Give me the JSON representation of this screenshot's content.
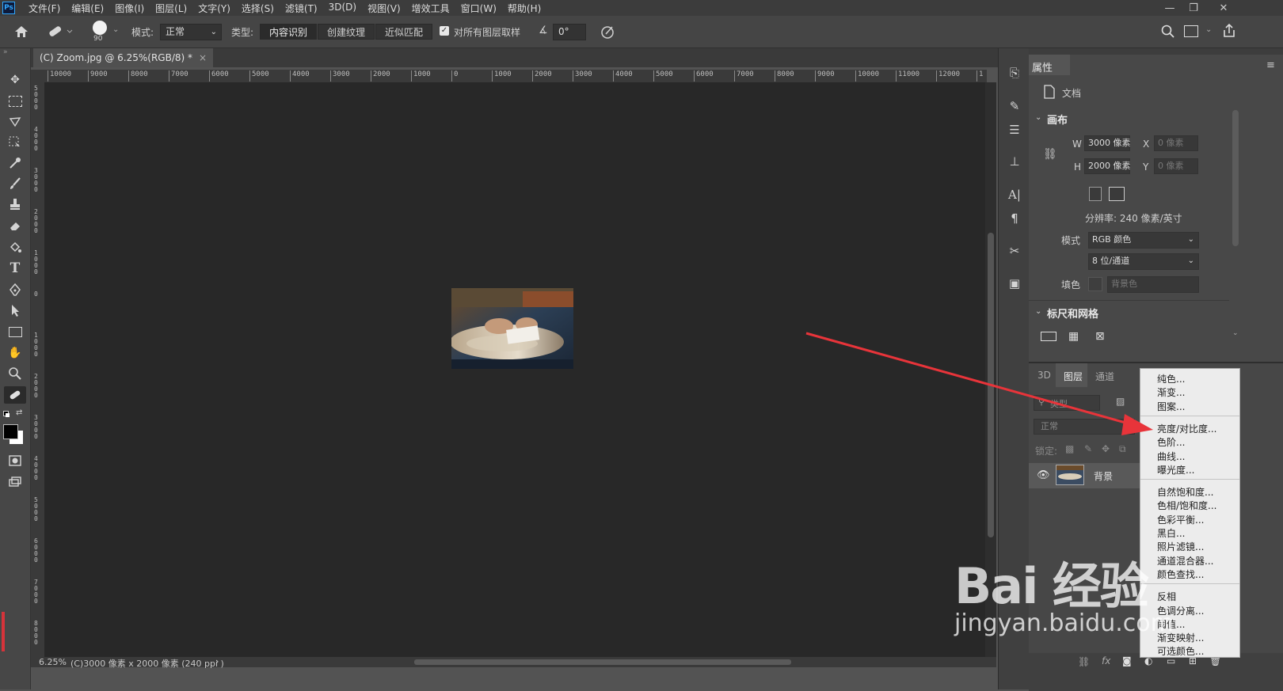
{
  "app": {
    "logo": "Ps"
  },
  "menubar": {
    "items": [
      "文件(F)",
      "编辑(E)",
      "图像(I)",
      "图层(L)",
      "文字(Y)",
      "选择(S)",
      "滤镜(T)",
      "3D(D)",
      "视图(V)",
      "增效工具",
      "窗口(W)",
      "帮助(H)"
    ]
  },
  "window_controls": {
    "minimize": "—",
    "restore": "❐",
    "close": "✕"
  },
  "options_bar": {
    "brush_size": "90",
    "mode_label": "模式:",
    "mode_value": "正常",
    "type_label": "类型:",
    "type_buttons": [
      "内容识别",
      "创建纹理",
      "近似匹配"
    ],
    "sample_all_layers": "对所有图层取样",
    "sample_all_checked": true,
    "angle_value": "0°"
  },
  "document": {
    "tab_title": "(C) Zoom.jpg @ 6.25%(RGB/8) *",
    "tab_close": "×",
    "zoom": "6.25%",
    "status": "(C)3000 像素 x 2000 像素 (240 ppi )"
  },
  "rulers": {
    "horizontal": [
      "10000",
      "9000",
      "8000",
      "7000",
      "6000",
      "5000",
      "4000",
      "3000",
      "2000",
      "1000",
      "0",
      "1000",
      "2000",
      "3000",
      "4000",
      "5000",
      "6000",
      "7000",
      "8000",
      "9000",
      "10000",
      "11000",
      "12000",
      "1"
    ],
    "vertical": [
      "5000",
      "4000",
      "3000",
      "2000",
      "1000",
      "0",
      "1000",
      "2000",
      "3000",
      "4000",
      "5000",
      "6000",
      "7000",
      "8000"
    ]
  },
  "properties": {
    "title": "属性",
    "doc_label": "文档",
    "canvas_section": "画布",
    "w_label": "W",
    "w_value": "3000 像素",
    "h_label": "H",
    "h_value": "2000 像素",
    "x_label": "X",
    "x_value": "0 像素",
    "y_label": "Y",
    "y_value": "0 像素",
    "resolution": "分辨率: 240 像素/英寸",
    "mode_label": "模式",
    "mode_value": "RGB 颜色",
    "depth_value": "8 位/通道",
    "fill_label": "填色",
    "fill_value": "背景色",
    "rulers_section": "标尺和网格"
  },
  "layers_panel": {
    "tabs": [
      "3D",
      "图层",
      "通道"
    ],
    "active_tab": "图层",
    "search_placeholder": "类型",
    "blend_mode": "正常",
    "lock_label": "锁定:",
    "layer_name": "背景"
  },
  "adjustment_menu": {
    "groups": [
      [
        "纯色...",
        "渐变...",
        "图案..."
      ],
      [
        "亮度/对比度...",
        "色阶...",
        "曲线...",
        "曝光度..."
      ],
      [
        "自然饱和度...",
        "色相/饱和度...",
        "色彩平衡...",
        "黑白...",
        "照片滤镜...",
        "通道混合器...",
        "颜色查找..."
      ],
      [
        "反相",
        "色调分离...",
        "阈值...",
        "渐变映射...",
        "可选颜色..."
      ]
    ]
  },
  "watermark": {
    "brand": "Bai 经验",
    "url": "jingyan.baidu.com"
  },
  "colors": {
    "arrow": "#e8343a",
    "ps_blue": "#31a8ff",
    "canvas": "#282828"
  }
}
